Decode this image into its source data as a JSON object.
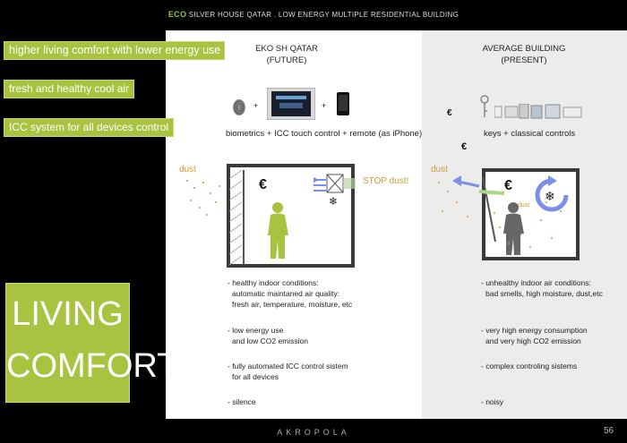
{
  "header": {
    "eco": "ECO",
    "rest": " SILVER HOUSE QATAR  .  LOW ENERGY MULTIPLE RESIDENTIAL BUILDING"
  },
  "tags": [
    "higher living comfort with lower energy use",
    "fresh and healthy cool air",
    "ICC system for all devices control"
  ],
  "big_box": {
    "line1": "LIVING",
    "line2": "COMFORT"
  },
  "left_column": {
    "title": "EKO SH QATAR",
    "subtitle": "(FUTURE)",
    "caption": "biometrics + ICC touch control + remote (as iPhone)",
    "plus": "+",
    "dust": "dust",
    "stop_dust": "STOP dust!",
    "euro": "€",
    "bullets": [
      [
        "- healthy indoor conditions:",
        "  automatic maintaned air quality:",
        "  fresh air, temperature, moisture, etc"
      ],
      [
        "- low energy use",
        "  and low CO2 emission"
      ],
      [
        "- fully automated ICC control sistem",
        "  for all devices"
      ],
      [
        "- silence"
      ]
    ]
  },
  "right_column": {
    "title": "AVERAGE BUILDING",
    "subtitle": "(PRESENT)",
    "caption": "keys + classical controls",
    "dust": "dust",
    "dust_small": "dust",
    "euro": "€",
    "bullets": [
      [
        "- unhealthy indoor air conditions:",
        "  bad smells, high moisture, dust,etc"
      ],
      [
        "- very high energy consumption",
        "  and very high CO2 emission"
      ],
      [
        "- complex controling sistems"
      ],
      [
        "- noisy"
      ]
    ]
  },
  "footer": {
    "logo": "AKROPOLA",
    "page": "56"
  },
  "colors": {
    "accent": "#a9c23f",
    "dust": "#d49a3a",
    "arrow_blue": "#7b8ee8",
    "figure_green": "#a9c23f"
  }
}
